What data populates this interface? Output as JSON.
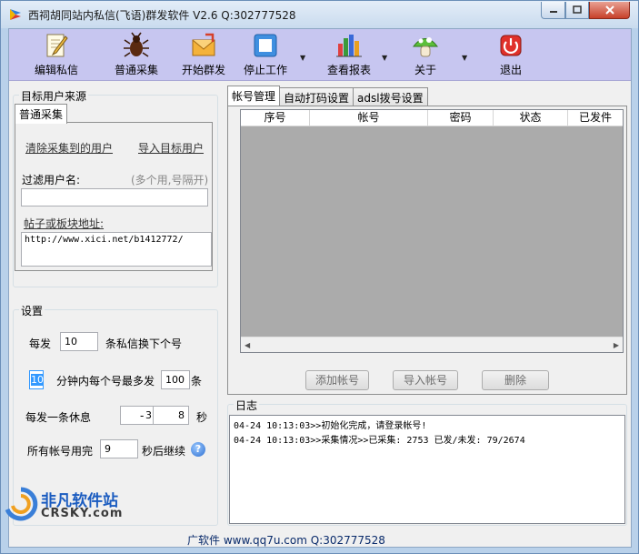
{
  "window": {
    "title": "西祠胡同站内私信(飞语)群发软件  V2.6  Q:302777528"
  },
  "toolbar": {
    "items": [
      {
        "label": "编辑私信",
        "icon": "pencil-note-icon"
      },
      {
        "label": "普通采集",
        "icon": "bug-icon"
      },
      {
        "label": "开始群发",
        "icon": "envelope-icon"
      },
      {
        "label": "停止工作",
        "icon": "stop-square-icon"
      },
      {
        "label": "查看报表",
        "icon": "bar-report-icon"
      },
      {
        "label": "关于",
        "icon": "mushroom-icon"
      },
      {
        "label": "退出",
        "icon": "power-exit-icon"
      }
    ]
  },
  "source": {
    "group_title": "目标用户来源",
    "tab_label": "普通采集",
    "clear_link": "清除采集到的用户",
    "import_link": "导入目标用户",
    "filter_label": "过滤用户名:",
    "filter_hint": "(多个用,号隔开)",
    "filter_value": "",
    "url_label": "帖子或板块地址:",
    "url_value": "http://www.xici.net/b1412772/"
  },
  "settings": {
    "group_title": "设置",
    "row1_prefix": "每发",
    "row1_value": "10",
    "row1_suffix": "条私信换下个号",
    "row2_value1": "10",
    "row2_middle": "分钟内每个号最多发",
    "row2_value2": "100",
    "row2_suffix": "条",
    "row3_prefix": "每发一条休息",
    "row3_min": "3",
    "row3_dash": "-",
    "row3_max": "8",
    "row3_suffix": "秒",
    "row4_prefix": "所有帐号用完",
    "row4_value": "9",
    "row4_suffix": "秒后继续"
  },
  "accounts": {
    "tabs": [
      "帐号管理",
      "自动打码设置",
      "adsl拨号设置"
    ],
    "columns": [
      "序号",
      "帐号",
      "密码",
      "状态",
      "已发件"
    ],
    "add_button": "添加帐号",
    "import_button": "导入帐号",
    "delete_button": "删除"
  },
  "log": {
    "title": "日志",
    "lines": [
      "04-24 10:13:03>>初始化完成，请登录帐号!",
      "04-24 10:13:03>>采集情况>>已采集: 2753 已发/未发: 79/2674"
    ]
  },
  "status": {
    "text": "广软件  www.qq7u.com Q:302777528"
  },
  "watermark": {
    "brand": "非凡软件站",
    "sub": "CRSKY.com"
  },
  "colors": {
    "toolbar_bg": "#c7c6f0",
    "grid_bg": "#ababab",
    "close_red": "#c7402a"
  }
}
